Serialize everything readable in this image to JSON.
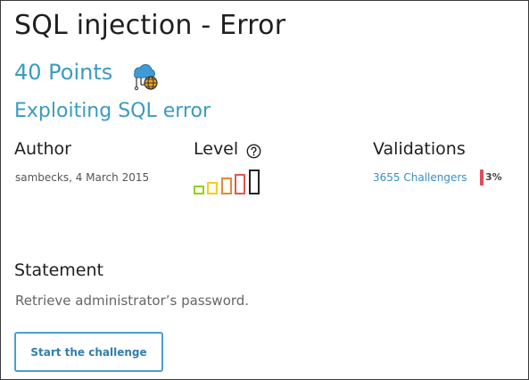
{
  "challenge": {
    "title": "SQL injection - Error",
    "points": "40 Points",
    "category_icon": "cloud-network-icon",
    "subtitle": "Exploiting SQL error"
  },
  "author": {
    "heading": "Author",
    "info": "sambecks,  4 March 2015"
  },
  "level": {
    "heading": "Level",
    "help_icon": "question-circle-icon",
    "value": 4,
    "max": 5,
    "bar_colors": [
      "#8fd400",
      "#f2d11b",
      "#e08a3a",
      "#e8554a",
      "#222222"
    ]
  },
  "validations": {
    "heading": "Validations",
    "challengers": "3655 Challengers",
    "percent_label": "3%",
    "percent_value": 3,
    "bar_color": "#e04a5a"
  },
  "statement": {
    "heading": "Statement",
    "text": "Retrieve administrator’s password."
  },
  "actions": {
    "start_label": "Start the challenge"
  },
  "colors": {
    "accent": "#3b9bc2",
    "border": "#3a3a3a"
  }
}
